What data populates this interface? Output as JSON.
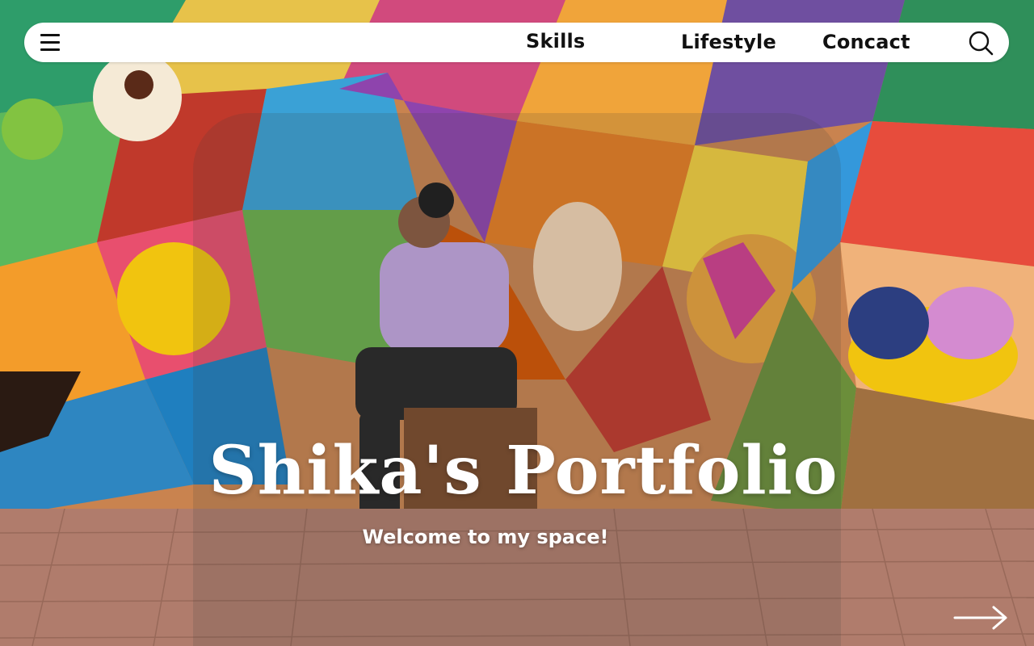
{
  "nav": {
    "menu_icon": "hamburger-menu-icon",
    "links": [
      {
        "label": "Skills"
      },
      {
        "label": "Lifestyle"
      },
      {
        "label": "Concact"
      }
    ],
    "search_icon": "search-icon"
  },
  "hero": {
    "title": "Shika's Portfolio",
    "subtitle": "Welcome to my space!",
    "next_icon": "arrow-right-icon"
  },
  "colors": {
    "nav_background": "#ffffff",
    "nav_text": "#111111",
    "hero_text": "#ffffff"
  }
}
